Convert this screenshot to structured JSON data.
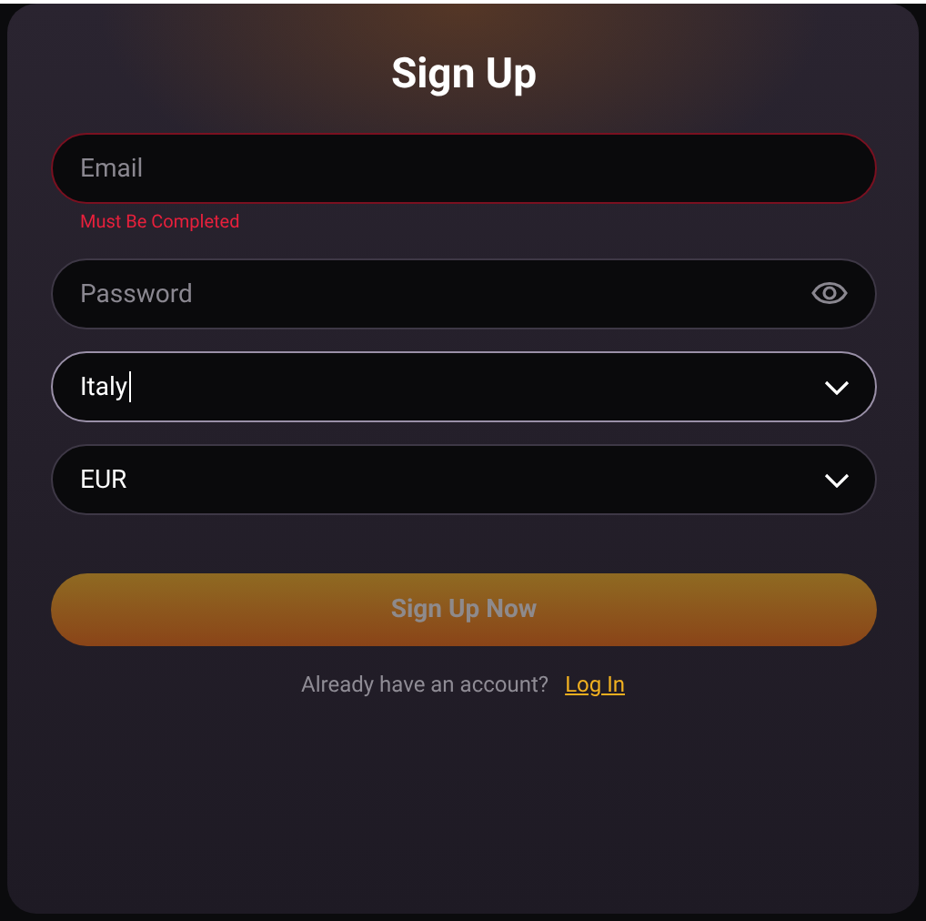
{
  "title": "Sign Up",
  "fields": [
    {
      "kind": "text",
      "placeholder": "Email",
      "invalid": true,
      "focused": false,
      "error": "Must Be Completed"
    },
    {
      "kind": "password",
      "placeholder": "Password",
      "invalid": false,
      "focused": false
    },
    {
      "kind": "select",
      "value": "Italy",
      "invalid": false,
      "focused": true
    },
    {
      "kind": "select",
      "value": "EUR",
      "invalid": false,
      "focused": false
    }
  ],
  "submit": {
    "label": "Sign Up Now",
    "disabled": true
  },
  "footer": {
    "text": "Already have an account?",
    "link": "Log In"
  }
}
